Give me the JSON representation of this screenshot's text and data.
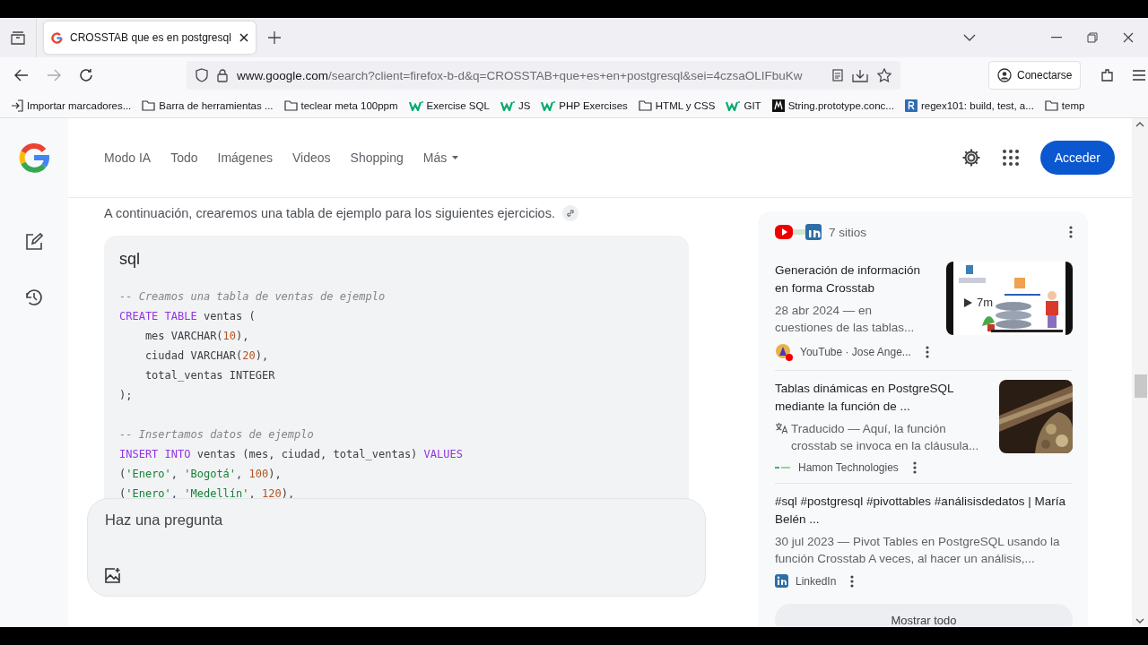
{
  "browser": {
    "tabs": [
      {
        "title": "CROSSTAB que es en postgresql",
        "selected": true
      }
    ],
    "url": {
      "domain": "www.google.com",
      "path": "/search?client=firefox-b-d&q=CROSSTAB+que+es+en+postgresql&sei=4czsaOLIFbuKw"
    },
    "account_button": "Conectarse",
    "bookmarks": [
      {
        "kind": "import",
        "label": "Importar marcadores..."
      },
      {
        "kind": "folder",
        "label": "Barra de herramientas ..."
      },
      {
        "kind": "folder",
        "label": "teclear meta 100ppm"
      },
      {
        "kind": "w3",
        "label": "Exercise SQL"
      },
      {
        "kind": "w3",
        "label": "JS"
      },
      {
        "kind": "w3",
        "label": "PHP Exercises"
      },
      {
        "kind": "folder",
        "label": "HTML y CSS"
      },
      {
        "kind": "w3",
        "label": "GIT"
      },
      {
        "kind": "m",
        "label": "String.prototype.conc..."
      },
      {
        "kind": "r",
        "label": "regex101: build, test, a..."
      },
      {
        "kind": "folder",
        "label": "temp"
      }
    ]
  },
  "page": {
    "nav": [
      {
        "label": "Modo IA",
        "dropdown": false
      },
      {
        "label": "Todo",
        "dropdown": false
      },
      {
        "label": "Imágenes",
        "dropdown": false
      },
      {
        "label": "Videos",
        "dropdown": false
      },
      {
        "label": "Shopping",
        "dropdown": false
      },
      {
        "label": "Más",
        "dropdown": true
      }
    ],
    "sign_in": "Acceder",
    "intro": "A continuación, crearemos una tabla de ejemplo para los siguientes ejercicios.",
    "code": {
      "language": "sql",
      "statements": [
        {
          "lines": [
            [
              {
                "kind": "comment",
                "text": "-- Creamos una tabla de ventas de ejemplo"
              }
            ],
            [
              {
                "kind": "keyword",
                "text": "CREATE TABLE"
              },
              {
                "kind": "plain",
                "text": " ventas ("
              }
            ],
            [
              {
                "kind": "plain",
                "text": "    mes VARCHAR("
              },
              {
                "kind": "number",
                "text": "10"
              },
              {
                "kind": "plain",
                "text": "),"
              }
            ],
            [
              {
                "kind": "plain",
                "text": "    ciudad VARCHAR("
              },
              {
                "kind": "number",
                "text": "20"
              },
              {
                "kind": "plain",
                "text": "),"
              }
            ],
            [
              {
                "kind": "plain",
                "text": "    total_ventas INTEGER"
              }
            ],
            [
              {
                "kind": "plain",
                "text": ");"
              }
            ]
          ]
        },
        {
          "lines": [
            [
              {
                "kind": "comment",
                "text": "-- Insertamos datos de ejemplo"
              }
            ],
            [
              {
                "kind": "keyword",
                "text": "INSERT INTO"
              },
              {
                "kind": "plain",
                "text": " ventas (mes, ciudad, total_ventas) "
              },
              {
                "kind": "keyword",
                "text": "VALUES"
              }
            ],
            [
              {
                "kind": "plain",
                "text": "("
              },
              {
                "kind": "string",
                "text": "'Enero'"
              },
              {
                "kind": "plain",
                "text": ", "
              },
              {
                "kind": "string",
                "text": "'Bogotá'"
              },
              {
                "kind": "plain",
                "text": ", "
              },
              {
                "kind": "number",
                "text": "100"
              },
              {
                "kind": "plain",
                "text": "),"
              }
            ],
            [
              {
                "kind": "plain",
                "text": "("
              },
              {
                "kind": "string",
                "text": "'Enero'"
              },
              {
                "kind": "plain",
                "text": ", "
              },
              {
                "kind": "string",
                "text": "'Medellín'"
              },
              {
                "kind": "plain",
                "text": ", "
              },
              {
                "kind": "number",
                "text": "120"
              },
              {
                "kind": "plain",
                "text": "),"
              }
            ]
          ]
        }
      ]
    },
    "question_box": {
      "placeholder": "Haz una pregunta"
    },
    "sources": {
      "count": "7 sitios",
      "results": [
        {
          "title": "Generación de información en forma Crosstab",
          "translated": false,
          "snippet": "28 abr 2024 — en cuestiones de las tablas...",
          "source": "YouTube · Jose Ange...",
          "kind": "video",
          "duration": "7m"
        },
        {
          "title": "Tablas dinámicas en PostgreSQL mediante la función de ...",
          "translated": true,
          "snippet": "Traducido — Aquí, la función crosstab se invoca en la cláusula...",
          "source": "Hamon Technologies",
          "kind": "article"
        },
        {
          "title": "#sql #postgresql #pivottables #análisisdedatos | María Belén ...",
          "translated": false,
          "snippet": "30 jul 2023 — Pivot Tables en PostgreSQL usando la función Crosstab A veces, al hacer un análisis,...",
          "source": "LinkedIn",
          "kind": "post"
        }
      ],
      "show_all": "Mostrar todo"
    }
  }
}
